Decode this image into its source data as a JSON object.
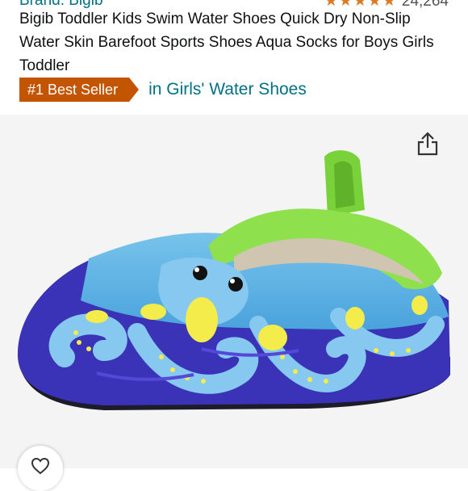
{
  "product": {
    "brand_label": "Brand: Bigib",
    "rating_stars": "★★★★★",
    "rating_count": "24,264",
    "title": "Bigib Toddler Kids Swim Water Shoes Quick Dry Non-Slip Water Skin Barefoot Sports Shoes Aqua Socks for Boys Girls Toddler",
    "badge_label": "#1 Best Seller",
    "badge_category": "in Girls' Water Shoes"
  },
  "colors": {
    "link": "#007185",
    "badge": "#c45500",
    "star": "#de7921"
  },
  "icons": {
    "share": "share-icon",
    "favorite": "heart-icon"
  }
}
